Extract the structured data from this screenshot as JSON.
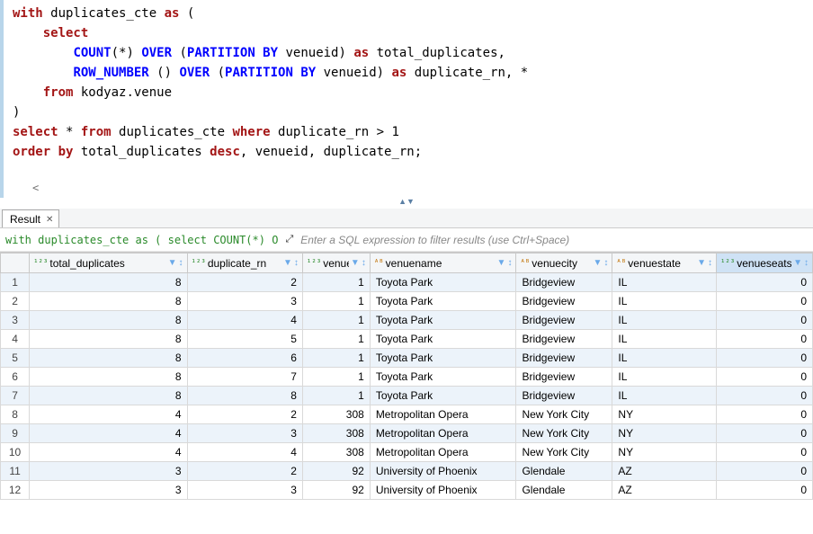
{
  "editor": {
    "sql_lines": [
      [
        [
          "kw-red",
          "with"
        ],
        [
          "plain",
          " duplicates_cte "
        ],
        [
          "kw-red",
          "as"
        ],
        [
          "plain",
          " ("
        ]
      ],
      [
        [
          "plain",
          "    "
        ],
        [
          "kw-red",
          "select"
        ]
      ],
      [
        [
          "plain",
          "        "
        ],
        [
          "kw-blue",
          "COUNT"
        ],
        [
          "plain",
          "(*) "
        ],
        [
          "kw-blue",
          "OVER"
        ],
        [
          "plain",
          " ("
        ],
        [
          "kw-blue",
          "PARTITION BY"
        ],
        [
          "plain",
          " venueid) "
        ],
        [
          "kw-red",
          "as"
        ],
        [
          "plain",
          " total_duplicates,"
        ]
      ],
      [
        [
          "plain",
          "        "
        ],
        [
          "kw-blue",
          "ROW_NUMBER"
        ],
        [
          "plain",
          " () "
        ],
        [
          "kw-blue",
          "OVER"
        ],
        [
          "plain",
          " ("
        ],
        [
          "kw-blue",
          "PARTITION BY"
        ],
        [
          "plain",
          " venueid) "
        ],
        [
          "kw-red",
          "as"
        ],
        [
          "plain",
          " duplicate_rn, *"
        ]
      ],
      [
        [
          "plain",
          "    "
        ],
        [
          "kw-red",
          "from"
        ],
        [
          "plain",
          " kodyaz.venue"
        ]
      ],
      [
        [
          "plain",
          ")"
        ]
      ],
      [
        [
          "kw-red",
          "select"
        ],
        [
          "plain",
          " * "
        ],
        [
          "kw-red",
          "from"
        ],
        [
          "plain",
          " duplicates_cte "
        ],
        [
          "kw-red",
          "where"
        ],
        [
          "plain",
          " duplicate_rn > 1"
        ]
      ],
      [
        [
          "kw-red",
          "order by"
        ],
        [
          "plain",
          " total_duplicates "
        ],
        [
          "kw-red",
          "desc"
        ],
        [
          "plain",
          ", venueid, duplicate_rn;"
        ]
      ]
    ],
    "hscroll_glyph": "<"
  },
  "collapse_glyph": "▲▼",
  "result_tab": {
    "label": "Result",
    "close": "✕"
  },
  "status": {
    "sql_preview": "with duplicates_cte as ( select COUNT(*) O",
    "expand_icon": "⤢",
    "filter_placeholder": "Enter a SQL expression to filter results (use Ctrl+Space)"
  },
  "columns": [
    {
      "name": "total_duplicates",
      "type": "num",
      "width": 164,
      "selected": false
    },
    {
      "name": "duplicate_rn",
      "type": "num",
      "width": 120,
      "selected": false
    },
    {
      "name": "venueid",
      "type": "num",
      "width": 70,
      "selected": false
    },
    {
      "name": "venuename",
      "type": "abc",
      "width": 152,
      "selected": false
    },
    {
      "name": "venuecity",
      "type": "abc",
      "width": 100,
      "selected": false
    },
    {
      "name": "venuestate",
      "type": "abc",
      "width": 108,
      "selected": false
    },
    {
      "name": "venueseats",
      "type": "num",
      "width": 100,
      "selected": true
    }
  ],
  "rows": [
    {
      "n": 1,
      "total_duplicates": 8,
      "duplicate_rn": 2,
      "venueid": 1,
      "venuename": "Toyota Park",
      "venuecity": "Bridgeview",
      "venuestate": "IL",
      "venueseats": 0
    },
    {
      "n": 2,
      "total_duplicates": 8,
      "duplicate_rn": 3,
      "venueid": 1,
      "venuename": "Toyota Park",
      "venuecity": "Bridgeview",
      "venuestate": "IL",
      "venueseats": 0
    },
    {
      "n": 3,
      "total_duplicates": 8,
      "duplicate_rn": 4,
      "venueid": 1,
      "venuename": "Toyota Park",
      "venuecity": "Bridgeview",
      "venuestate": "IL",
      "venueseats": 0
    },
    {
      "n": 4,
      "total_duplicates": 8,
      "duplicate_rn": 5,
      "venueid": 1,
      "venuename": "Toyota Park",
      "venuecity": "Bridgeview",
      "venuestate": "IL",
      "venueseats": 0
    },
    {
      "n": 5,
      "total_duplicates": 8,
      "duplicate_rn": 6,
      "venueid": 1,
      "venuename": "Toyota Park",
      "venuecity": "Bridgeview",
      "venuestate": "IL",
      "venueseats": 0
    },
    {
      "n": 6,
      "total_duplicates": 8,
      "duplicate_rn": 7,
      "venueid": 1,
      "venuename": "Toyota Park",
      "venuecity": "Bridgeview",
      "venuestate": "IL",
      "venueseats": 0
    },
    {
      "n": 7,
      "total_duplicates": 8,
      "duplicate_rn": 8,
      "venueid": 1,
      "venuename": "Toyota Park",
      "venuecity": "Bridgeview",
      "venuestate": "IL",
      "venueseats": 0
    },
    {
      "n": 8,
      "total_duplicates": 4,
      "duplicate_rn": 2,
      "venueid": 308,
      "venuename": "Metropolitan Opera",
      "venuecity": "New York City",
      "venuestate": "NY",
      "venueseats": 0
    },
    {
      "n": 9,
      "total_duplicates": 4,
      "duplicate_rn": 3,
      "venueid": 308,
      "venuename": "Metropolitan Opera",
      "venuecity": "New York City",
      "venuestate": "NY",
      "venueseats": 0
    },
    {
      "n": 10,
      "total_duplicates": 4,
      "duplicate_rn": 4,
      "venueid": 308,
      "venuename": "Metropolitan Opera",
      "venuecity": "New York City",
      "venuestate": "NY",
      "venueseats": 0
    },
    {
      "n": 11,
      "total_duplicates": 3,
      "duplicate_rn": 2,
      "venueid": 92,
      "venuename": "University of Phoenix",
      "venuecity": "Glendale",
      "venuestate": "AZ",
      "venueseats": 0
    },
    {
      "n": 12,
      "total_duplicates": 3,
      "duplicate_rn": 3,
      "venueid": 92,
      "venuename": "University of Phoenix",
      "venuecity": "Glendale",
      "venuestate": "AZ",
      "venueseats": 0
    }
  ]
}
